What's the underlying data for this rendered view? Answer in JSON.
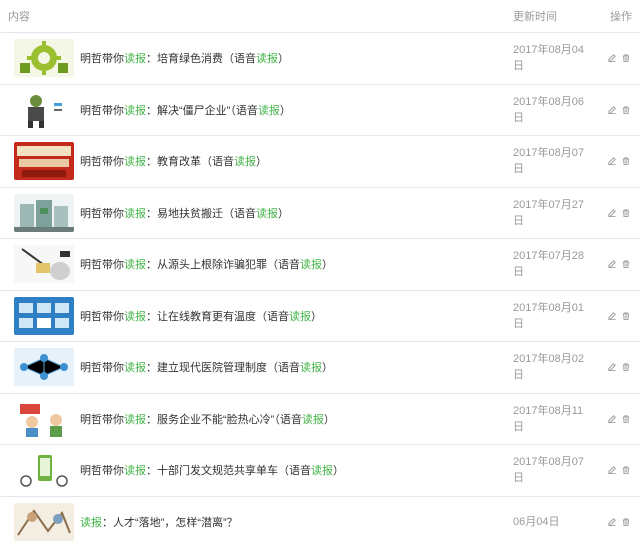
{
  "header": {
    "content_label": "内容",
    "time_label": "更新时间",
    "ops_label": "操作"
  },
  "rows": [
    {
      "prefix": "明哲带你",
      "hl": "读报",
      "mid": "：培育绿色消费（语音",
      "hl2": "读报",
      "end": "）",
      "date": "2017年08月04日",
      "thumb": "green-gear"
    },
    {
      "prefix": "明哲带你",
      "hl": "读报",
      "mid": "：解决“僵尸企业”（语音",
      "hl2": "读报",
      "end": "）",
      "date": "2017年08月06日",
      "thumb": "zombie"
    },
    {
      "prefix": "明哲带你",
      "hl": "读报",
      "mid": "：教育改革（语音",
      "hl2": "读报",
      "end": "）",
      "date": "2017年08月07日",
      "thumb": "red-banner"
    },
    {
      "prefix": "明哲带你",
      "hl": "读报",
      "mid": "：易地扶贫搬迁（语音",
      "hl2": "读报",
      "end": "）",
      "date": "2017年07月27日",
      "thumb": "buildings"
    },
    {
      "prefix": "明哲带你",
      "hl": "读报",
      "mid": "：从源头上根除诈骗犯罪（语音",
      "hl2": "读报",
      "end": "）",
      "date": "2017年07月28日",
      "thumb": "hook"
    },
    {
      "prefix": "明哲带你",
      "hl": "读报",
      "mid": "：让在线教育更有温度（语音",
      "hl2": "读报",
      "end": "）",
      "date": "2017年08月01日",
      "thumb": "screens"
    },
    {
      "prefix": "明哲带你",
      "hl": "读报",
      "mid": "：建立现代医院管理制度（语音",
      "hl2": "读报",
      "end": "）",
      "date": "2017年08月02日",
      "thumb": "network"
    },
    {
      "prefix": "明哲带你",
      "hl": "读报",
      "mid": "：服务企业不能“脸热心冷”（语音",
      "hl2": "读报",
      "end": "）",
      "date": "2017年08月11日",
      "thumb": "cartoon"
    },
    {
      "prefix": "明哲带你",
      "hl": "读报",
      "mid": "：十部门发文规范共享单车（语音",
      "hl2": "读报",
      "end": "）",
      "date": "2017年08月07日",
      "thumb": "phone-bike"
    },
    {
      "prefix": "",
      "hl": "读报",
      "mid": "：人才“落地”，怎样“潜离”？",
      "hl2": "",
      "end": "",
      "date": "06月04日",
      "thumb": "sketch"
    }
  ],
  "icons": {
    "edit": "edit-icon",
    "delete": "trash-icon"
  },
  "colors": {
    "accent": "#44b549",
    "muted": "#9a9a9a",
    "border": "#e7e7eb"
  }
}
